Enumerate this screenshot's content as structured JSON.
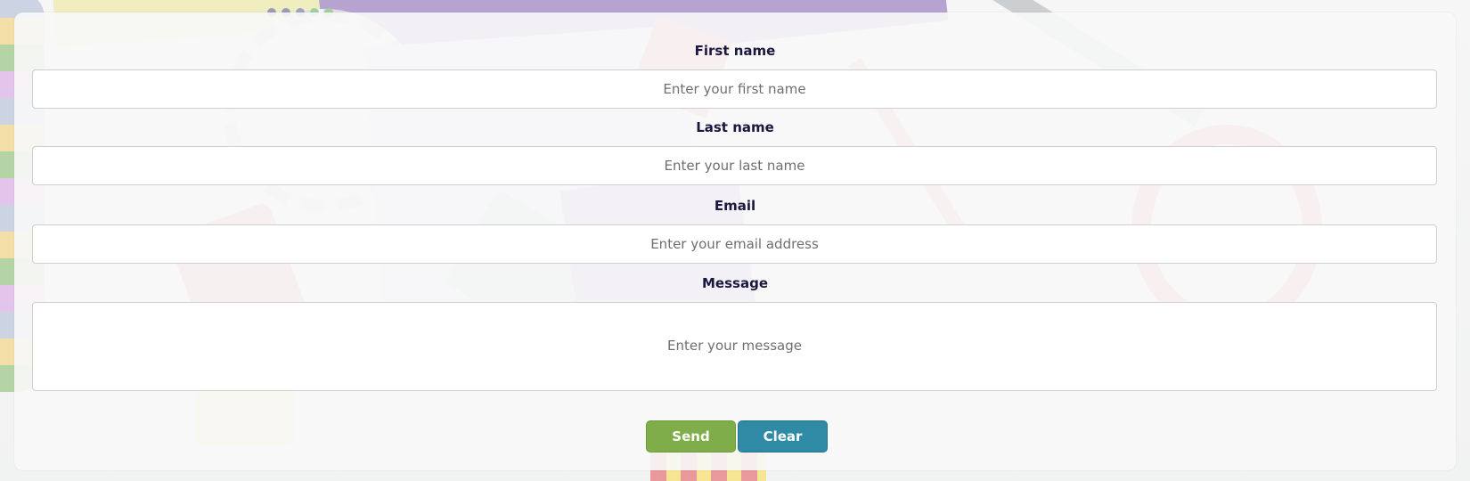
{
  "form": {
    "first_name": {
      "label": "First name",
      "placeholder": "Enter your first name",
      "value": ""
    },
    "last_name": {
      "label": "Last name",
      "placeholder": "Enter your last name",
      "value": ""
    },
    "email": {
      "label": "Email",
      "placeholder": "Enter your email address",
      "value": ""
    },
    "message": {
      "label": "Message",
      "placeholder": "Enter your message",
      "value": ""
    },
    "buttons": {
      "send_label": "Send",
      "clear_label": "Clear"
    }
  },
  "colors": {
    "label_text": "#1b1840",
    "send_button": "#7fad4a",
    "clear_button": "#2f8aa6",
    "card_background": "#f8f8f8"
  }
}
